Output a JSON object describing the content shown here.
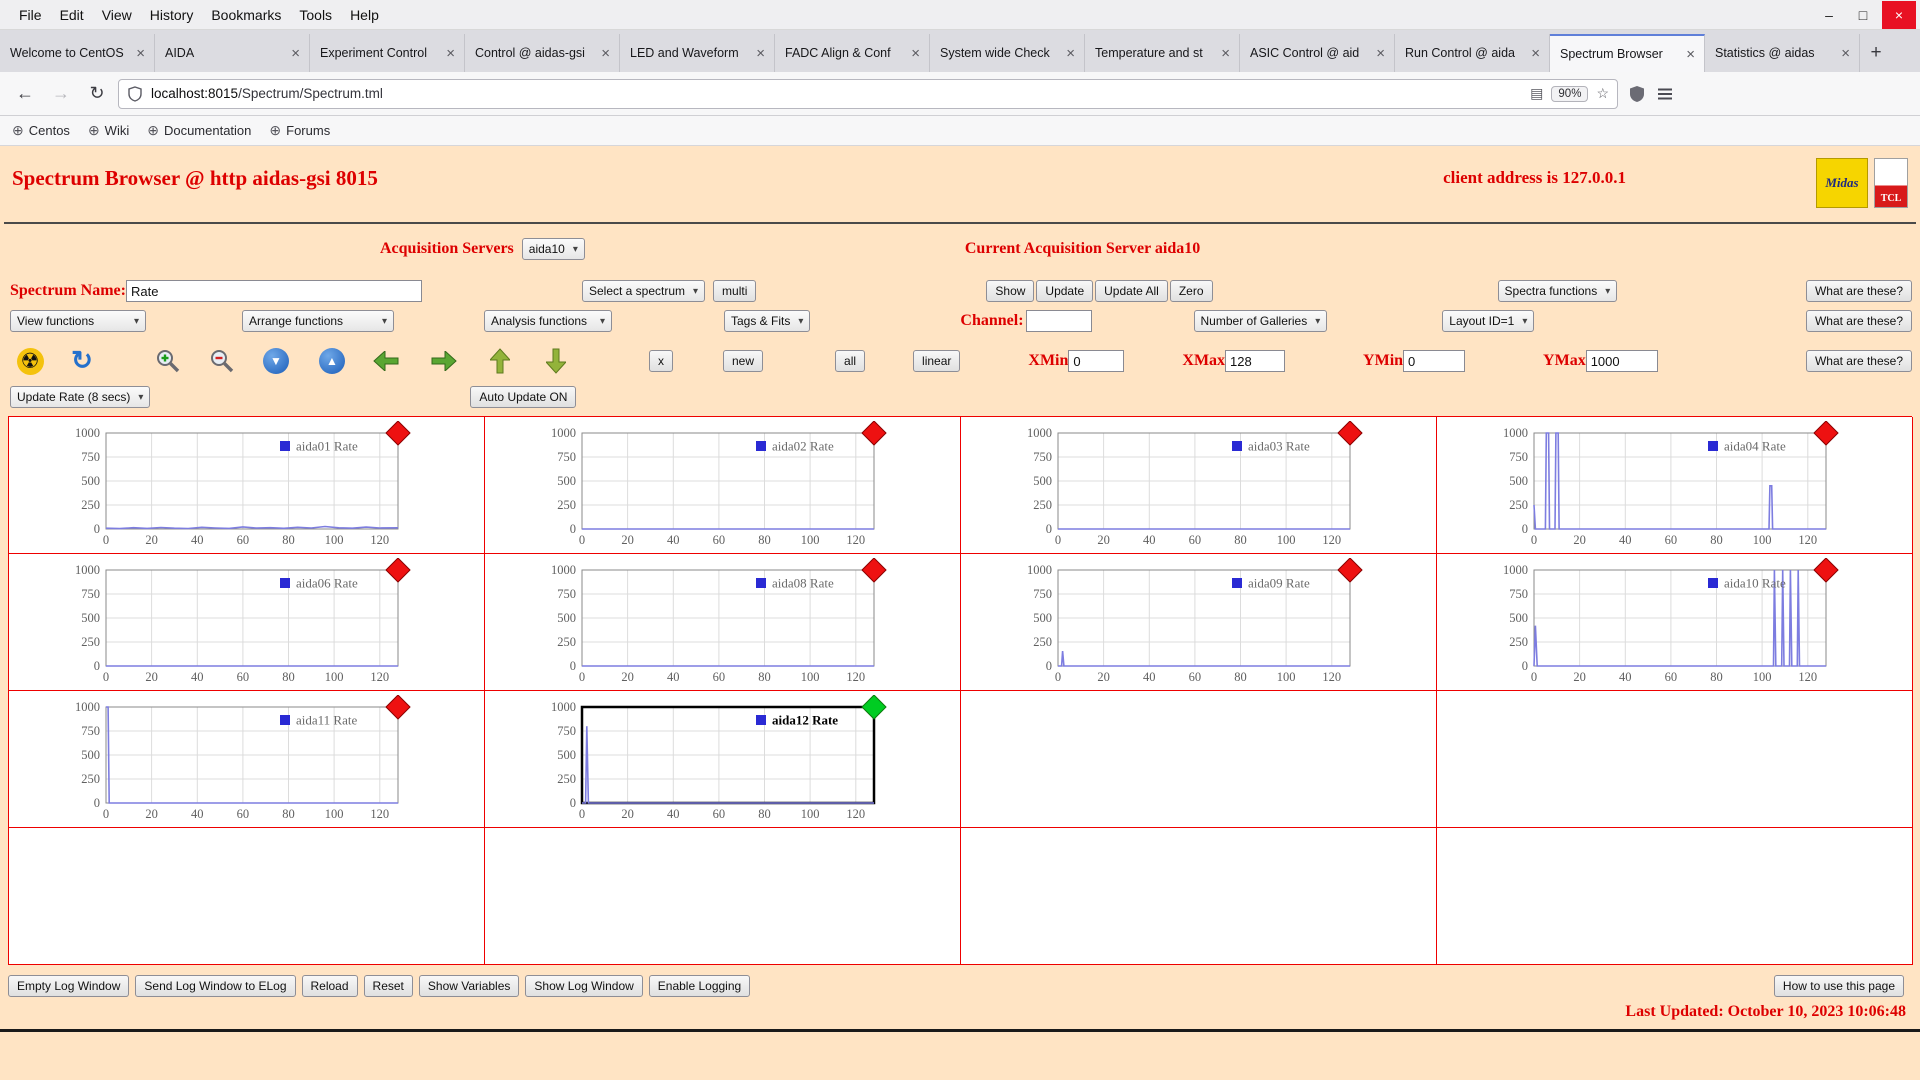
{
  "icons": {
    "dropdown": "▾",
    "globe": "⊕",
    "tab_close": "×",
    "radiation": "☢",
    "refresh": "↻",
    "reader": "▤",
    "star": "☆",
    "back": "←",
    "forward": "→",
    "reload": "↻",
    "arrow_down": "▼",
    "arrow_up": "▲",
    "minimize": "–",
    "maximize": "□",
    "close": "×",
    "new_tab": "+"
  },
  "browser": {
    "menu_items": [
      "File",
      "Edit",
      "View",
      "History",
      "Bookmarks",
      "Tools",
      "Help"
    ],
    "tabs": [
      {
        "title": "Welcome to CentOS",
        "active": false
      },
      {
        "title": "AIDA",
        "active": false
      },
      {
        "title": "Experiment Control",
        "active": false
      },
      {
        "title": "Control @ aidas-gsi",
        "active": false
      },
      {
        "title": "LED and Waveform",
        "active": false
      },
      {
        "title": "FADC Align & Conf",
        "active": false
      },
      {
        "title": "System wide Check",
        "active": false
      },
      {
        "title": "Temperature and st",
        "active": false
      },
      {
        "title": "ASIC Control @ aid",
        "active": false
      },
      {
        "title": "Run Control @ aida",
        "active": false
      },
      {
        "title": "Spectrum Browser",
        "active": true
      },
      {
        "title": "Statistics @ aidas",
        "active": false
      }
    ],
    "nav": {
      "url_host": "localhost:8015",
      "url_path": "/Spectrum/Spectrum.tml",
      "zoom_level": "90%"
    },
    "bookmarks": [
      {
        "label": "Centos"
      },
      {
        "label": "Wiki"
      },
      {
        "label": "Documentation"
      },
      {
        "label": "Forums"
      }
    ]
  },
  "page": {
    "title": "Spectrum Browser @ http aidas-gsi 8015",
    "client_address": "client address is 127.0.0.1",
    "logos": {
      "midas": "Midas",
      "tcl": "TCL"
    },
    "acquisition_label": "Acquisition Servers",
    "acquisition_value": "aida10",
    "current_server": "Current Acquisition Server aida10",
    "spectrum_name_label": "Spectrum Name:",
    "spectrum_name_value": "Rate",
    "select_spectrum": "Select a spectrum",
    "multi_btn": "multi",
    "show_btn": "Show",
    "update_btn": "Update",
    "update_all_btn": "Update All",
    "zero_btn": "Zero",
    "spectra_functions": "Spectra functions",
    "what_are_these": "What are these?",
    "view_functions": "View functions",
    "arrange_functions": "Arrange functions",
    "analysis_functions": "Analysis functions",
    "tags_fits": "Tags & Fits",
    "channel_label": "Channel:",
    "channel_value": "",
    "num_galleries": "Number of Galleries",
    "layout_id": "Layout ID=1",
    "x_btn": "x",
    "new_btn": "new",
    "all_btn": "all",
    "linear_btn": "linear",
    "xmin_label": "XMin",
    "xmin_value": "0",
    "xmax_label": "XMax",
    "xmax_value": "128",
    "ymin_label": "YMin",
    "ymin_value": "0",
    "ymax_label": "YMax",
    "ymax_value": "1000",
    "update_rate": "Update Rate (8 secs)",
    "auto_update_btn": "Auto Update ON",
    "footer_buttons": [
      "Empty Log Window",
      "Send Log Window to ELog",
      "Reload",
      "Reset",
      "Show Variables",
      "Show Log Window",
      "Enable Logging"
    ],
    "how_to_btn": "How to use this page",
    "last_updated": "Last Updated: October 10, 2023 10:06:48"
  },
  "chart_data": {
    "type": "line",
    "title": "",
    "xlabel": "",
    "ylabel": "",
    "xlim": [
      0,
      128
    ],
    "ylim": [
      0,
      1000
    ],
    "x_ticks": [
      0,
      20,
      40,
      60,
      80,
      100,
      120
    ],
    "y_ticks": [
      0,
      250,
      500,
      750,
      1000
    ],
    "grid": true,
    "legend_position": "top-right",
    "line_color": "#7d7de0",
    "legend_square_color": "#2a2ad4",
    "grid_rows": 4,
    "grid_cols": 4,
    "charts": [
      {
        "cell": 0,
        "name": "aida01 Rate",
        "marker": "red",
        "selected": false,
        "points": [
          [
            0,
            8
          ],
          [
            6,
            4
          ],
          [
            12,
            14
          ],
          [
            18,
            6
          ],
          [
            24,
            16
          ],
          [
            30,
            8
          ],
          [
            36,
            5
          ],
          [
            42,
            18
          ],
          [
            48,
            10
          ],
          [
            54,
            6
          ],
          [
            60,
            22
          ],
          [
            66,
            9
          ],
          [
            72,
            14
          ],
          [
            78,
            7
          ],
          [
            84,
            18
          ],
          [
            90,
            10
          ],
          [
            96,
            26
          ],
          [
            102,
            12
          ],
          [
            108,
            8
          ],
          [
            114,
            20
          ],
          [
            120,
            10
          ],
          [
            128,
            12
          ]
        ]
      },
      {
        "cell": 1,
        "name": "aida02 Rate",
        "marker": "red",
        "selected": false,
        "points": [
          [
            0,
            0
          ],
          [
            128,
            0
          ]
        ]
      },
      {
        "cell": 2,
        "name": "aida03 Rate",
        "marker": "red",
        "selected": false,
        "points": [
          [
            0,
            0
          ],
          [
            128,
            0
          ]
        ]
      },
      {
        "cell": 3,
        "name": "aida04 Rate",
        "marker": "red",
        "selected": false,
        "points": [
          [
            0,
            250
          ],
          [
            0.6,
            0
          ],
          [
            5,
            0
          ],
          [
            5.4,
            1000
          ],
          [
            6.4,
            1000
          ],
          [
            6.8,
            0
          ],
          [
            9.2,
            0
          ],
          [
            9.6,
            1000
          ],
          [
            10.6,
            1000
          ],
          [
            11,
            0
          ],
          [
            103,
            0
          ],
          [
            103.4,
            450
          ],
          [
            104.2,
            450
          ],
          [
            104.6,
            0
          ],
          [
            128,
            0
          ]
        ]
      },
      {
        "cell": 4,
        "name": "aida06 Rate",
        "marker": "red",
        "selected": false,
        "points": [
          [
            0,
            0
          ],
          [
            128,
            0
          ]
        ]
      },
      {
        "cell": 5,
        "name": "aida08 Rate",
        "marker": "red",
        "selected": false,
        "points": [
          [
            0,
            0
          ],
          [
            128,
            0
          ]
        ]
      },
      {
        "cell": 6,
        "name": "aida09 Rate",
        "marker": "red",
        "selected": false,
        "points": [
          [
            0,
            0
          ],
          [
            1.6,
            0
          ],
          [
            2,
            155
          ],
          [
            2.6,
            0
          ],
          [
            128,
            0
          ]
        ]
      },
      {
        "cell": 7,
        "name": "aida10 Rate",
        "marker": "red",
        "selected": false,
        "points": [
          [
            0,
            0
          ],
          [
            0.6,
            420
          ],
          [
            1.4,
            0
          ],
          [
            105,
            0
          ],
          [
            105.4,
            1000
          ],
          [
            106,
            0
          ],
          [
            108.6,
            0
          ],
          [
            109,
            1000
          ],
          [
            109.6,
            0
          ],
          [
            112,
            0
          ],
          [
            112.4,
            1000
          ],
          [
            113,
            0
          ],
          [
            115.4,
            0
          ],
          [
            115.8,
            1000
          ],
          [
            116.4,
            0
          ],
          [
            128,
            0
          ]
        ]
      },
      {
        "cell": 8,
        "name": "aida11 Rate",
        "marker": "red",
        "selected": false,
        "points": [
          [
            0,
            1000
          ],
          [
            0.9,
            1000
          ],
          [
            1.4,
            0
          ],
          [
            128,
            0
          ]
        ]
      },
      {
        "cell": 9,
        "name": "aida12 Rate",
        "marker": "green",
        "selected": true,
        "points": [
          [
            0,
            0
          ],
          [
            1.6,
            0
          ],
          [
            2.1,
            800
          ],
          [
            2.8,
            0
          ],
          [
            128,
            0
          ]
        ]
      }
    ]
  }
}
